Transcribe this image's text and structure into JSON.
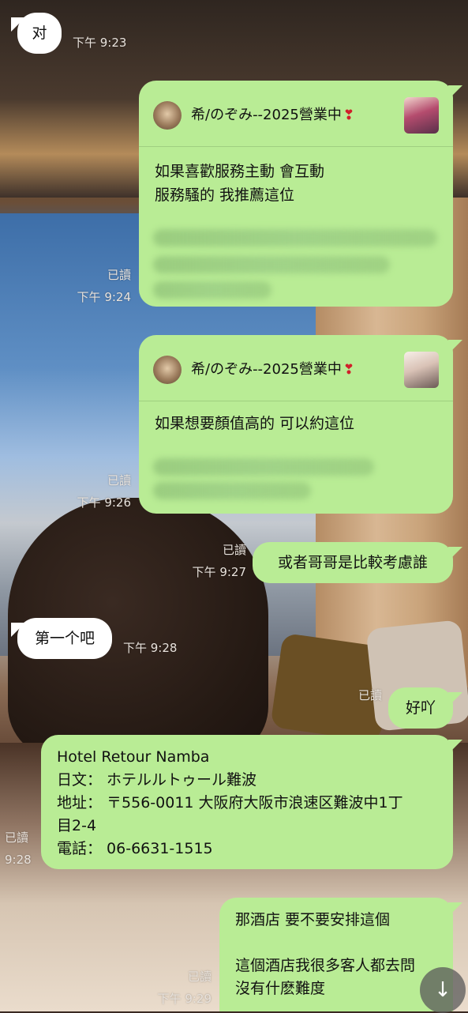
{
  "messages": {
    "m1": {
      "text": "对",
      "time": "下午 9:23"
    },
    "m2": {
      "read": "已讀",
      "time": "下午 9:24",
      "share_name": "希/のぞみ--2025營業中",
      "heart": "❣",
      "text": "如果喜歡服務主動  會互動\n服務騷的  我推薦這位"
    },
    "m3": {
      "read": "已讀",
      "time": "下午 9:26",
      "share_name": "希/のぞみ--2025營業中",
      "heart": "❣",
      "text": "如果想要顏值高的  可以約這位"
    },
    "m4": {
      "read": "已讀",
      "time": "下午 9:27",
      "text": "或者哥哥是比較考慮誰"
    },
    "m5": {
      "text": "第一个吧",
      "time": "下午 9:28"
    },
    "m6": {
      "read": "已讀",
      "text": "好吖"
    },
    "m7": {
      "read": "已讀",
      "time": "9:28",
      "line1": "Hotel Retour Namba",
      "line2": "日文：  ホテルルトゥール難波",
      "line3": "地址：  〒556-0011 大阪府大阪市浪速区難波中1丁",
      "line4": "目2-4",
      "line5": "電話：  06-6631-1515"
    },
    "m8": {
      "read": "已讀",
      "time": "下午 9:29",
      "line1": "那酒店  要不要安排這個",
      "line2": "這個酒店我很多客人都去問",
      "line3": "沒有什麽難度"
    }
  },
  "scroll_button": {
    "icon": "arrow-down-icon",
    "glyph": "↓"
  }
}
